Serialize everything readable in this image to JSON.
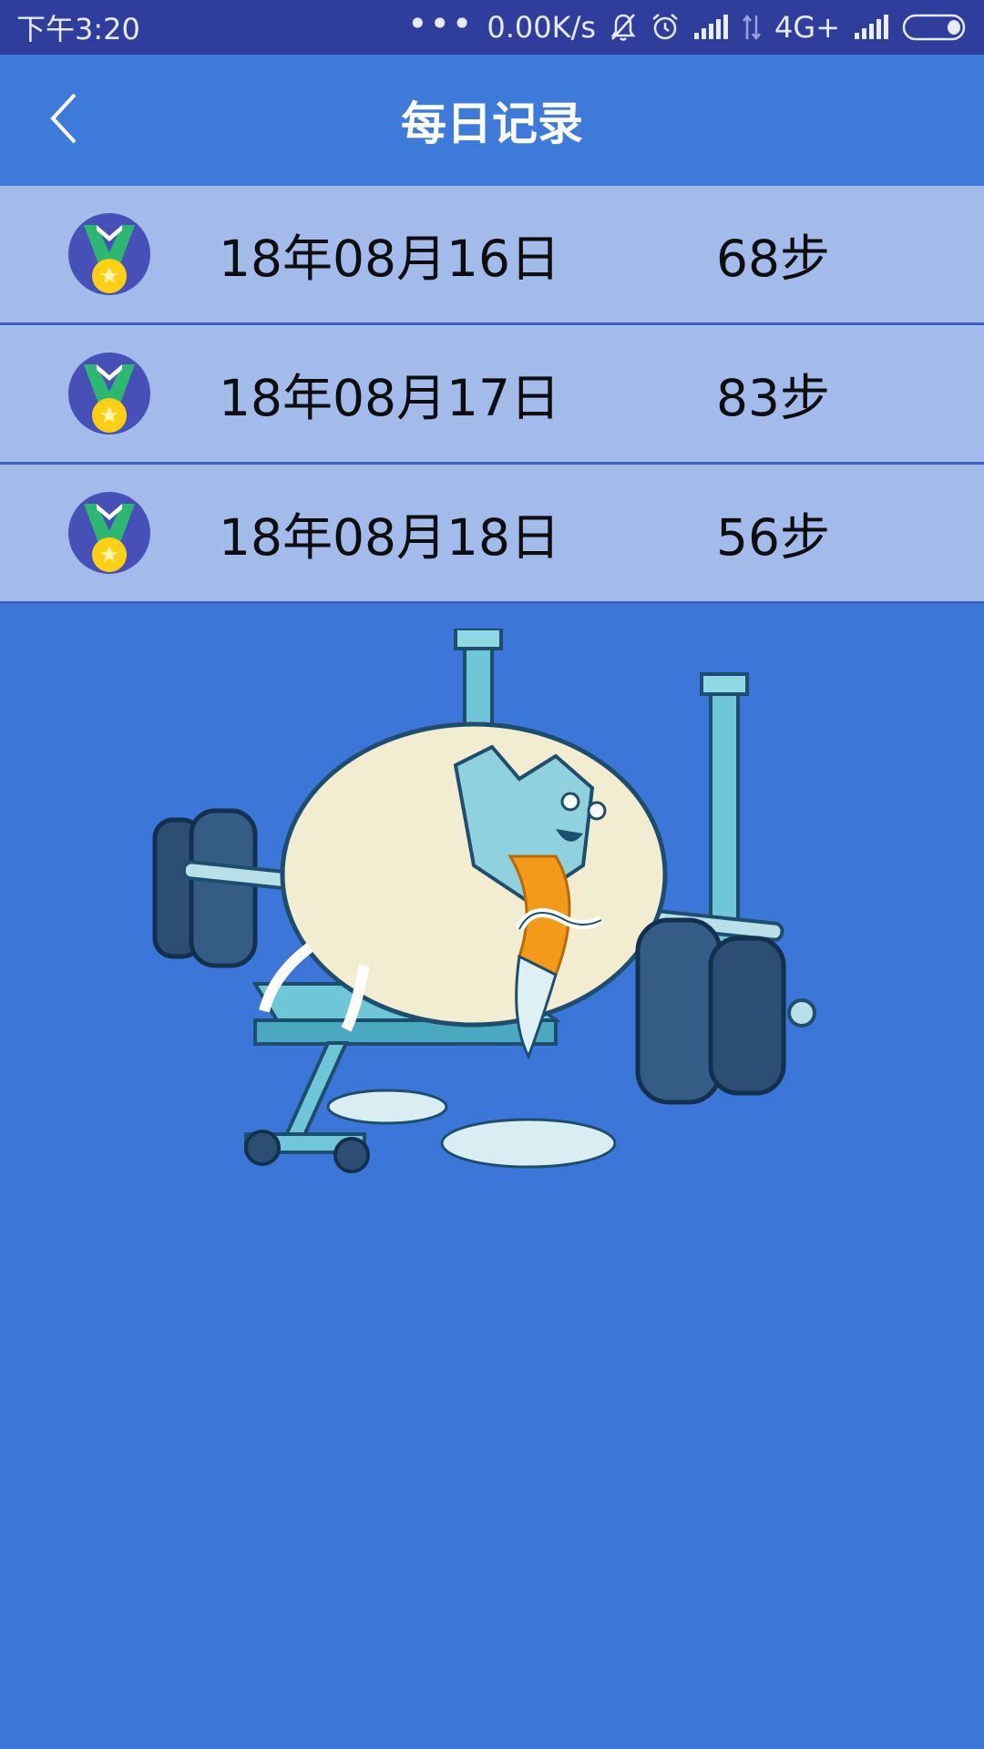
{
  "status_bar": {
    "time": "下午3:20",
    "dots": "•••",
    "network_speed": "0.00K/s",
    "network_type": "4G+",
    "icons": [
      "mute-bell-icon",
      "alarm-icon",
      "signal-icon",
      "data-arrows-icon",
      "signal-icon",
      "battery-icon"
    ]
  },
  "header": {
    "title": "每日记录",
    "back_icon": "chevron-left-icon",
    "background": "#3d7ad9"
  },
  "records": [
    {
      "date": "18年08月16日",
      "steps": "68步",
      "icon": "medal-icon"
    },
    {
      "date": "18年08月17日",
      "steps": "83步",
      "icon": "medal-icon"
    },
    {
      "date": "18年08月18日",
      "steps": "56步",
      "icon": "medal-icon"
    }
  ],
  "colors": {
    "status_bar": "#2f3e9c",
    "page_background": "#3d76d9",
    "row_background": "#a2bbea",
    "row_divider": "#3a63bf"
  },
  "illustration": {
    "icon": "egg-weightlifting-illustration"
  }
}
